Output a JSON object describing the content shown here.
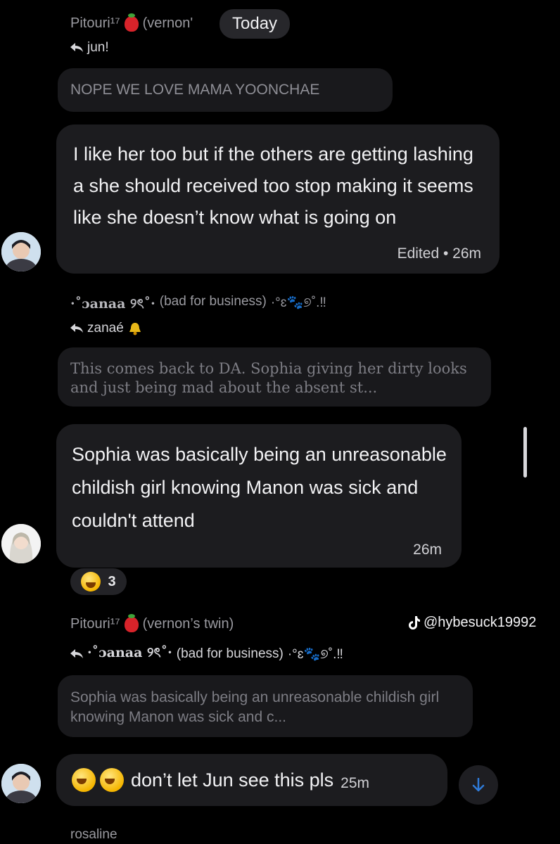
{
  "header": {
    "sender_name": "Pitouri¹⁷",
    "sender_nick_partial": "(vernon'",
    "date_pill": "Today",
    "reply_to": "jun!"
  },
  "messages": [
    {
      "quote": "NOPE WE LOVE MAMA YOONCHAE",
      "text": "I like her too but if the others are getting lashing a she should received too stop making it seems like she doesn’t know what is going on",
      "meta": "Edited • 26m"
    },
    {
      "sender_name": "·˚ɔanaa ୨ৎ˚·",
      "sender_nick": "(bad for business)",
      "sender_deco": "·°ɛ🐾୭˚.‼",
      "reply_to": "zanaé",
      "quote": "This comes back to DA. Sophia giving her dirty looks and just being mad about the absent st...",
      "text": "Sophia was basically being an unreasonable childish girl knowing Manon was sick and couldn't attend",
      "meta": "26m",
      "reaction_count": "3"
    },
    {
      "sender_name": "Pitouri¹⁷",
      "sender_nick": "(vernon’s twin)",
      "reply_to_name": "·˚ɔanaa ୨ৎ˚·",
      "reply_to_nick": "(bad for business)",
      "reply_to_deco": "·°ɛ🐾୭˚.‼",
      "quote": "Sophia was basically being an unreasonable childish girl knowing Manon was sick and c...",
      "text": "don’t let Jun see this pls",
      "meta": "25m"
    }
  ],
  "watermark": "@hybesuck19992",
  "next_sender_partial": "rosaline",
  "icons": [
    "reply-arrow-icon",
    "strawberry-icon",
    "bell-icon",
    "crying-emoji-icon",
    "tiktok-logo-icon",
    "scroll-down-arrow-icon"
  ],
  "colors": {
    "background": "#000000",
    "bubble": "#1c1c1f",
    "accent": "#2f7bd8"
  }
}
